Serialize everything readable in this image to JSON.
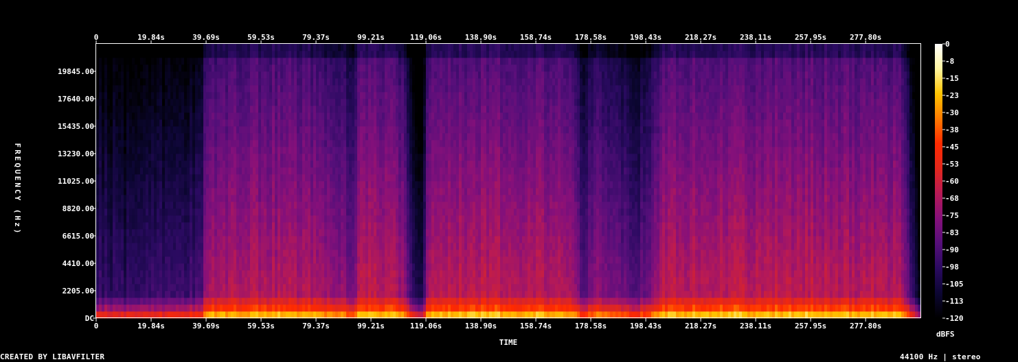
{
  "footer": {
    "left": "CREATED BY LIBAVFILTER",
    "right": "44100 Hz | stereo"
  },
  "chart_data": {
    "type": "heatmap",
    "title": "",
    "xlabel": "TIME",
    "ylabel": "FREQUENCY (Hz)",
    "x_ticks": [
      "0",
      "19.84s",
      "39.69s",
      "59.53s",
      "79.37s",
      "99.21s",
      "119.06s",
      "138.90s",
      "158.74s",
      "178.58s",
      "198.43s",
      "218.27s",
      "238.11s",
      "257.95s",
      "277.80s"
    ],
    "x_tick_values": [
      0,
      19.84,
      39.69,
      59.53,
      79.37,
      99.21,
      119.06,
      138.9,
      158.74,
      178.58,
      198.43,
      218.27,
      238.11,
      257.95,
      277.8
    ],
    "xlim": [
      0,
      297.6
    ],
    "y_ticks": [
      "DC",
      "2205.00",
      "4410.00",
      "6615.00",
      "8820.00",
      "11025.00",
      "13230.00",
      "15435.00",
      "17640.00",
      "19845.00"
    ],
    "y_tick_values": [
      0,
      2205,
      4410,
      6615,
      8820,
      11025,
      13230,
      15435,
      17640,
      19845
    ],
    "ylim": [
      0,
      22050
    ],
    "colorbar": {
      "label": "dBFS",
      "ticks": [
        "0",
        "-8",
        "-15",
        "-23",
        "-30",
        "-38",
        "-45",
        "-53",
        "-60",
        "-68",
        "-75",
        "-83",
        "-90",
        "-98",
        "-105",
        "-113",
        "-120"
      ],
      "range": [
        -120,
        0
      ],
      "colors": [
        "#000000",
        "#0c0633",
        "#2a0a60",
        "#560f7a",
        "#86107a",
        "#b81a55",
        "#e3271c",
        "#ff2a00",
        "#ff7a00",
        "#ffc400",
        "#fff5a0",
        "#ffffff"
      ]
    },
    "time_profile": {
      "t": [
        0,
        10,
        20,
        25,
        30,
        36,
        38,
        40,
        60,
        80,
        85,
        90,
        92,
        95,
        100,
        108,
        112,
        115,
        118,
        120,
        140,
        160,
        172,
        176,
        180,
        190,
        196,
        205,
        230,
        260,
        290,
        296,
        297.6
      ],
      "level_db": [
        -92,
        -96,
        -94,
        -92,
        -92,
        -90,
        -88,
        -66,
        -64,
        -66,
        -70,
        -72,
        -80,
        -64,
        -62,
        -62,
        -74,
        -100,
        -100,
        -64,
        -62,
        -63,
        -66,
        -88,
        -70,
        -80,
        -84,
        -63,
        -62,
        -62,
        -64,
        -100,
        -112
      ]
    },
    "grid": false
  }
}
